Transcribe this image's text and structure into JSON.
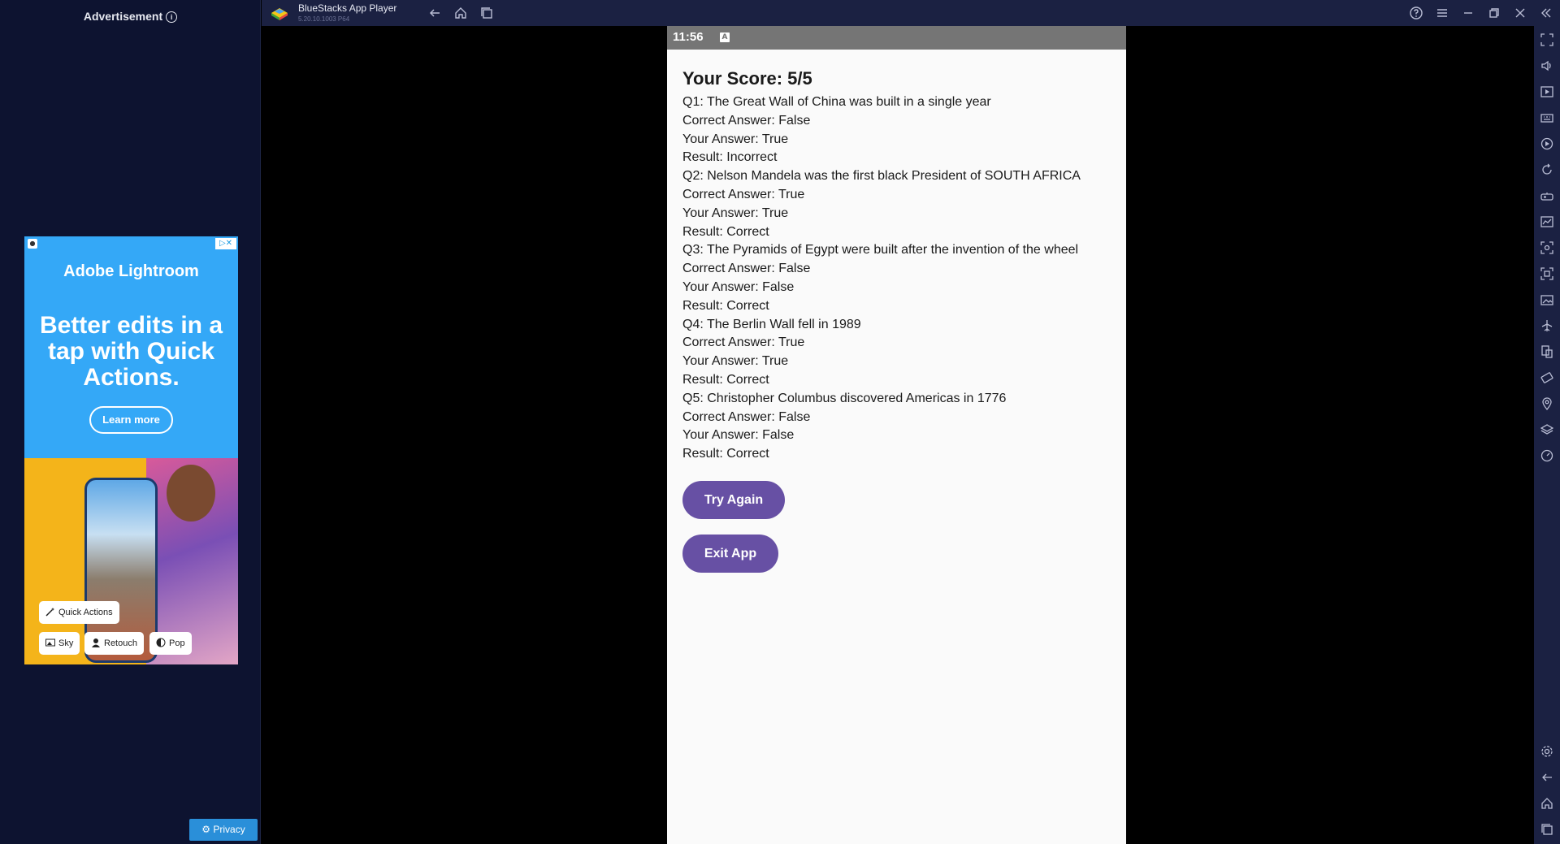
{
  "ad": {
    "label": "Advertisement",
    "info_icon": "i",
    "adchoices": "▷✕",
    "brand": "Adobe Lightroom",
    "headline": "Better edits in a tap with Quick Actions.",
    "cta": "Learn more",
    "chips": [
      "Quick Actions",
      "Sky",
      "Retouch",
      "Pop"
    ],
    "privacy": "Privacy"
  },
  "window": {
    "title": "BlueStacks App Player",
    "version": "5.20.10.1003 P64"
  },
  "status": {
    "time": "11:56"
  },
  "result": {
    "score_title": "Your Score: 5/5",
    "lines": [
      "Q1: The Great Wall of China was built in a single year",
      "Correct Answer: False",
      "Your Answer: True",
      "Result: Incorrect",
      "Q2: Nelson Mandela was the first black President of SOUTH AFRICA",
      "Correct Answer: True",
      "Your Answer: True",
      "Result: Correct",
      "Q3: The Pyramids of Egypt were built after the invention of the wheel",
      "Correct Answer: False",
      "Your Answer: False",
      "Result: Correct",
      "Q4: The Berlin Wall fell in 1989",
      "Correct Answer: True",
      "Your Answer: True",
      "Result: Correct",
      "Q5: Christopher Columbus discovered Americas in 1776",
      "Correct Answer: False",
      "Your Answer: False",
      "Result: Correct"
    ],
    "try_again": "Try Again",
    "exit_app": "Exit App"
  },
  "colors": {
    "button": "#6750a4",
    "status_bar": "#757575",
    "chrome": "#1b2142",
    "ad_panel": "#0d1330"
  }
}
